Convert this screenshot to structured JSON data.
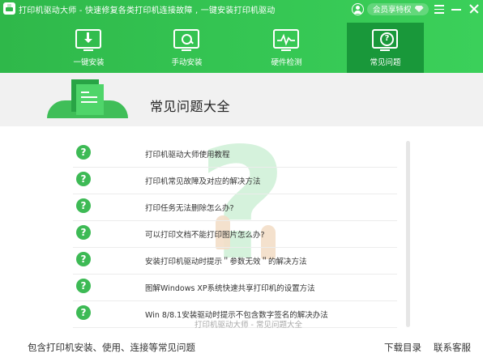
{
  "app": {
    "title": "打印机驱动大师 - 快速修复各类打印机连接故障 , 一键安装打印机驱动",
    "vip_label": "会员享特权"
  },
  "tabs": [
    {
      "label": "一键安装",
      "icon": "install-icon",
      "active": false
    },
    {
      "label": "手动安装",
      "icon": "manual-search-icon",
      "active": false
    },
    {
      "label": "硬件检测",
      "icon": "hardware-detect-icon",
      "active": false
    },
    {
      "label": "常见问题",
      "icon": "faq-icon",
      "active": true
    }
  ],
  "banner": {
    "title": "常见问题大全"
  },
  "faq": {
    "items": [
      "打印机驱动大师使用教程",
      "打印机常见故障及对应的解决方法",
      "打印任务无法删除怎么办?",
      "可以打印文档不能打印图片怎么办?",
      "安装打印机驱动时提示＂参数无效＂的解决方法",
      "图解Windows XP系统快速共享打印机的设置方法",
      "Win 8/8.1安装驱动时提示不包含数字签名的解决办法"
    ]
  },
  "watermark": "打印机驱动大师 - 常见问题大全",
  "footer": {
    "description": "包含打印机安装、使用、连接等常见问题",
    "download_label": "下载目录",
    "contact_label": "联系客服"
  },
  "colors": {
    "brand_green": "#34c452",
    "active_tab": "#19983a",
    "faq_icon": "#3dba55"
  }
}
